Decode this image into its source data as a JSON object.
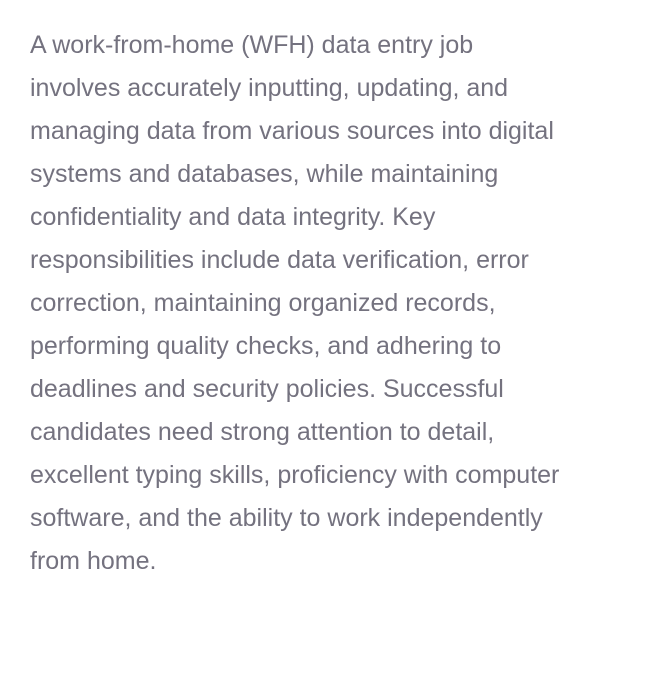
{
  "description": {
    "lines": [
      "A work-from-home (WFH) data entry job",
      "involves accurately inputting, updating, and",
      "managing data from various sources into digital",
      "systems and databases, while maintaining",
      "confidentiality and data integrity. Key",
      "responsibilities include data verification, error",
      "correction, maintaining organized records,",
      "performing quality checks, and adhering to",
      "deadlines and security policies. Successful",
      "candidates need strong attention to detail,",
      "excellent typing skills, proficiency with computer",
      "software, and the ability to work independently",
      "from home."
    ]
  },
  "colors": {
    "text": "#74727f",
    "background": "#ffffff"
  }
}
